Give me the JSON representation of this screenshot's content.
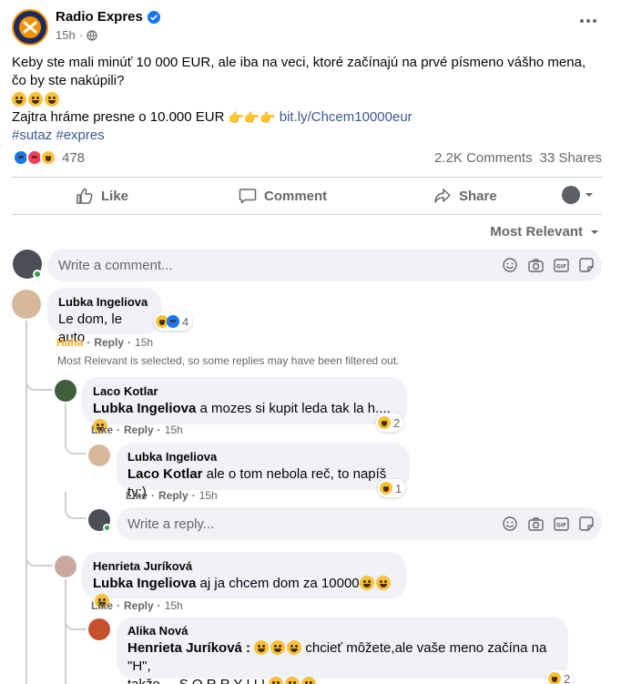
{
  "post": {
    "page_name": "Radio Expres",
    "time": "15h",
    "separator": "·",
    "text_line1": "Keby ste mali minúť 10 000 EUR, ale iba na veci, ktoré začínajú na prvé písmeno vášho mena, čo by ste nakúpili?",
    "text_line3_prefix": "Zajtra hráme presne o 10.000 EUR",
    "link": "bit.ly/Chcem10000eur",
    "hashtags": "#sutaz #expres",
    "reaction_count": "478",
    "comments_count": "2.2K Comments",
    "shares_count": "33 Shares"
  },
  "actions": {
    "like": "Like",
    "comment": "Comment",
    "share": "Share"
  },
  "sort": {
    "label": "Most Relevant"
  },
  "composer": {
    "placeholder": "Write a comment...",
    "reply_placeholder": "Write a reply..."
  },
  "comments": [
    {
      "author": "Lubka Ingeliova",
      "text": "Le dom, le auto",
      "reaction_count": "4",
      "reaction_label": "Haha",
      "reply_label": "Reply",
      "time": "15h",
      "filter_note": "Most Relevant is selected, so some replies may have been filtered out."
    }
  ],
  "replies": [
    {
      "author": "Laco Kotlar",
      "mention": "Lubka Ingeliova",
      "text": " a mozes si kupit leda tak la h....",
      "reaction_count": "2",
      "like_label": "Like",
      "reply_label": "Reply",
      "time": "15h"
    },
    {
      "author": "Lubka Ingeliova",
      "mention": "Laco Kotlar",
      "text": " ale o tom nebola reč, to napíš ty;)",
      "reaction_count": "1",
      "like_label": "Like",
      "reply_label": "Reply",
      "time": "15h"
    },
    {
      "author": "Henrieta Juríková",
      "mention": "Lubka Ingeliova",
      "text": " aj ja chcem dom za 10000",
      "like_label": "Like",
      "reply_label": "Reply",
      "time": "15h"
    },
    {
      "author": "Alika Nová",
      "mention": "Henrieta Juríková :",
      "text": " chcieť môžete,ale vaše meno začína na \"H\",",
      "text_line2": "takže ... S O R R Y ! ! !",
      "reaction_count": "2"
    }
  ],
  "colors": {
    "accent": "#1877f2",
    "link": "#385898",
    "muted": "#65676b",
    "bubble": "#f0f2f5",
    "brand_orange": "#f39200"
  }
}
